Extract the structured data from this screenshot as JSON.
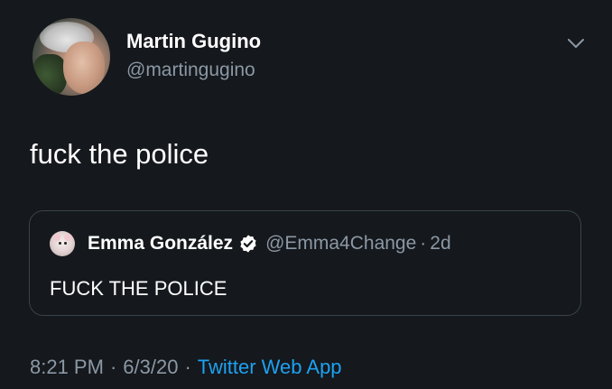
{
  "tweet": {
    "author": {
      "display_name": "Martin Gugino",
      "handle": "@martingugino",
      "avatar": "profile-photo"
    },
    "text": "fuck the police",
    "menu_icon": "chevron-down-icon",
    "quoted_tweet": {
      "display_name": "Emma González",
      "verified_icon": "verified-badge-icon",
      "handle": "@Emma4Change",
      "separator": "·",
      "age": "2d",
      "text": "FUCK THE POLICE"
    },
    "meta": {
      "time": "8:21 PM",
      "date": "6/3/20",
      "separator": "·",
      "source": "Twitter Web App"
    }
  },
  "colors": {
    "background": "#15181c",
    "primary_text": "#ffffff",
    "secondary_text": "#8b98a5",
    "link": "#1da1f2",
    "border": "#38444d"
  }
}
